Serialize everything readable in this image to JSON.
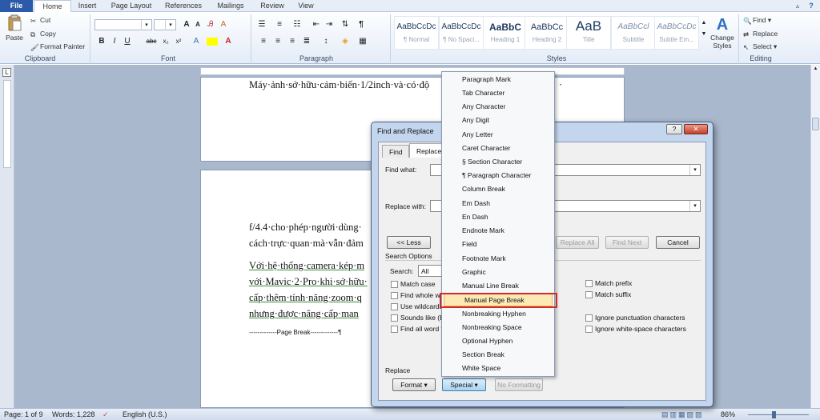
{
  "ribbon_tabs": [
    "File",
    "Home",
    "Insert",
    "Page Layout",
    "References",
    "Mailings",
    "Review",
    "View"
  ],
  "clipboard": {
    "paste": "Paste",
    "cut": "Cut",
    "copy": "Copy",
    "format_painter": "Format Painter",
    "label": "Clipboard"
  },
  "font_group": {
    "label": "Font",
    "bold": "B",
    "italic": "I",
    "underline": "U",
    "strike": "abc",
    "sub": "x₂",
    "sup": "x²",
    "grow": "A",
    "shrink": "A"
  },
  "paragraph_group": {
    "label": "Paragraph"
  },
  "styles_group": {
    "label": "Styles",
    "items": [
      {
        "preview": "AaBbCcDc",
        "name": "¶ Normal"
      },
      {
        "preview": "AaBbCcDc",
        "name": "¶ No Spaci..."
      },
      {
        "preview": "AaBbC",
        "name": "Heading 1"
      },
      {
        "preview": "AaBbCc",
        "name": "Heading 2"
      },
      {
        "preview": "AaB",
        "name": "Title"
      },
      {
        "preview": "AaBbCcl",
        "name": "Subtitle"
      },
      {
        "preview": "AaBbCcDc",
        "name": "Subtle Em..."
      }
    ],
    "change_styles": "Change Styles"
  },
  "editing_group": {
    "label": "Editing",
    "find": "Find",
    "replace": "Replace",
    "select": "Select"
  },
  "document": {
    "line_top": "Máy·ảnh·sở·hữu·cảm·biến·1/2inch·và·có·độ",
    "line_top_tail": "·",
    "para1_line1": "f/4.4·cho·phép·người·dùng·",
    "para1_line2": "cách·trực·quan·mà·vẫn·đảm",
    "para2_line1": "Với·hệ·thống·camera·kép·m",
    "para2_line2": "với·Mavic·2·Pro·khi·sở·hữu·",
    "para2_line3": "cấp·thêm·tính·năng·zoom·q",
    "para2_line4": "nhưng·được·nâng·cấp·man",
    "page_break": "-------------Page Break-------------¶"
  },
  "dialog": {
    "title": "Find and Replace",
    "help": "?",
    "close": "✕",
    "tabs": [
      "Find",
      "Replace"
    ],
    "find_what_label": "Find what:",
    "replace_with_label": "Replace with:",
    "less_button": "<< Less",
    "replace_all": "Replace All",
    "find_next": "Find Next",
    "cancel": "Cancel",
    "search_options": "Search Options",
    "search_label": "Search:",
    "search_value": "All",
    "left_options": [
      "Match case",
      "Find whole wo",
      "Use wildcards",
      "Sounds like (E",
      "Find all word f"
    ],
    "right_options": [
      "Match prefix",
      "Match suffix",
      "Ignore punctuation characters",
      "Ignore white-space characters"
    ],
    "replace_section": "Replace",
    "format_button": "Format ▾",
    "special_button": "Special ▾",
    "no_formatting": "No Formatting"
  },
  "special_menu": {
    "items": [
      "Paragraph Mark",
      "Tab Character",
      "Any Character",
      "Any Digit",
      "Any Letter",
      "Caret Character",
      "§ Section Character",
      "¶ Paragraph Character",
      "Column Break",
      "Em Dash",
      "En Dash",
      "Endnote Mark",
      "Field",
      "Footnote Mark",
      "Graphic",
      "Manual Line Break",
      "Manual Page Break",
      "Nonbreaking Hyphen",
      "Nonbreaking Space",
      "Optional Hyphen",
      "Section Break",
      "White Space"
    ],
    "highlighted_index": 16
  },
  "status_bar": {
    "page": "Page: 1 of 9",
    "words": "Words: 1,228",
    "language": "English (U.S.)",
    "zoom": "86%"
  }
}
